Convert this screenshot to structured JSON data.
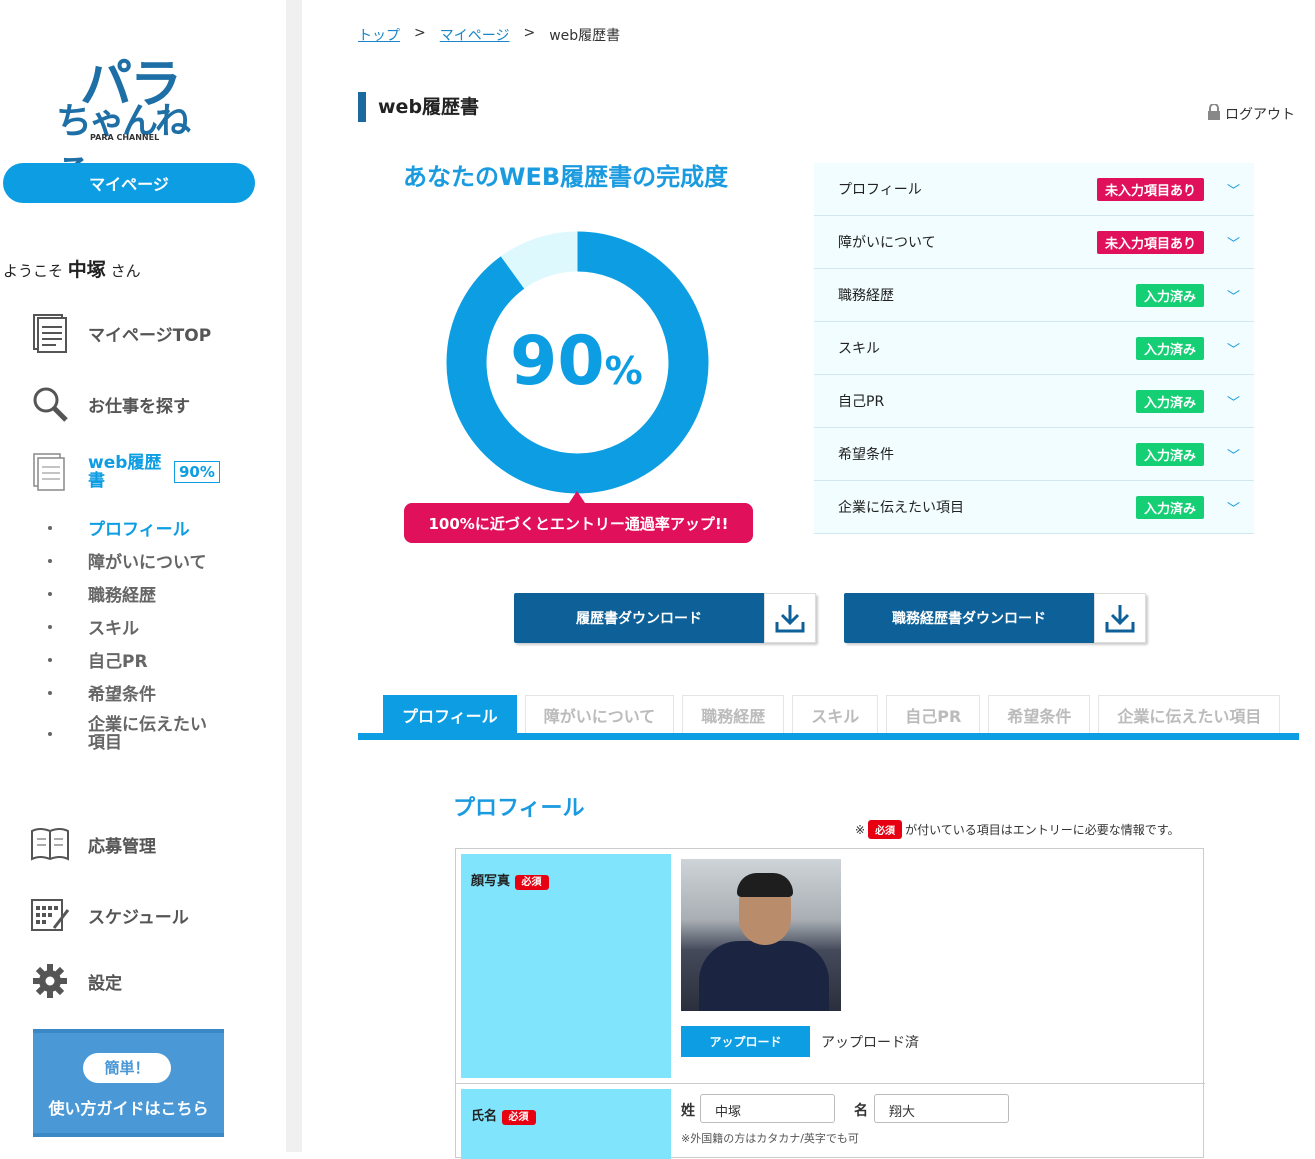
{
  "sidebar": {
    "logo_line1": "パラ",
    "logo_line2": "ちゃんねる",
    "logo_line3": "PARA CHANNEL",
    "mypage_label": "マイページ",
    "welcome_prefix": "ようこそ",
    "user_name": "中塚",
    "welcome_suffix": "さん",
    "nav": {
      "top": "マイページTOP",
      "jobs": "お仕事を探す",
      "resume": "web履歴書",
      "resume_pct": "90%",
      "applications": "応募管理",
      "schedule": "スケジュール",
      "settings": "設定"
    },
    "sub_items": [
      "プロフィール",
      "障がいについて",
      "職務経歴",
      "スキル",
      "自己PR",
      "希望条件",
      "企業に伝えたい項目"
    ],
    "guide_pill": "簡単！",
    "guide_text": "使い方ガイドはこちら"
  },
  "breadcrumb": [
    "トップ",
    "マイページ",
    "web履歴書"
  ],
  "breadcrumb_sep": ">",
  "page_title": "web履歴書",
  "logout": "ログアウト",
  "completion": {
    "title": "あなたのWEB履歴書の完成度",
    "value": 90,
    "value_num": "90",
    "value_unit": "%",
    "hint": "100%に近づくとエントリー通過率アップ!!"
  },
  "status_items": [
    {
      "label": "プロフィール",
      "status": "未入力項目あり",
      "state": "warn"
    },
    {
      "label": "障がいについて",
      "status": "未入力項目あり",
      "state": "warn"
    },
    {
      "label": "職務経歴",
      "status": "入力済み",
      "state": "ok"
    },
    {
      "label": "スキル",
      "status": "入力済み",
      "state": "ok"
    },
    {
      "label": "自己PR",
      "status": "入力済み",
      "state": "ok"
    },
    {
      "label": "希望条件",
      "status": "入力済み",
      "state": "ok"
    },
    {
      "label": "企業に伝えたい項目",
      "status": "入力済み",
      "state": "ok"
    }
  ],
  "downloads": {
    "resume": "履歴書ダウンロード",
    "career": "職務経歴書ダウンロード"
  },
  "tabs": [
    "プロフィール",
    "障がいについて",
    "職務経歴",
    "スキル",
    "自己PR",
    "希望条件",
    "企業に伝えたい項目"
  ],
  "active_tab": 0,
  "section": {
    "title": "プロフィール",
    "note_prefix": "※",
    "required": "必須",
    "note_suffix": "が付いている項目はエントリーに必要な情報です。"
  },
  "form": {
    "photo_label": "顔写真",
    "upload_button": "アップロード",
    "upload_status": "アップロード済",
    "name_label": "氏名",
    "last_name_label": "姓",
    "last_name_value": "中塚",
    "first_name_label": "名",
    "first_name_value": "翔大",
    "name_note": "※外国籍の方はカタカナ/英字でも可"
  },
  "colors": {
    "accent": "#0c9de3",
    "dark_blue": "#0d6198",
    "warn": "#e0105a",
    "ok": "#15cf75",
    "label_bg": "#80e4fc"
  }
}
